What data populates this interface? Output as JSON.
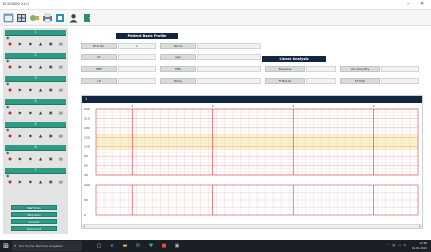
{
  "app": {
    "title": "ECG5000 v1.0"
  },
  "window_controls": {
    "minimize": "–",
    "close": "✕"
  },
  "toolbar": {
    "icons": [
      "open-file-icon",
      "grid-view-icon",
      "connect-device-icon",
      "print-icon",
      "export-icon",
      "user-icon",
      "exit-icon"
    ]
  },
  "sidebar": {
    "devices": [
      {
        "number": "1"
      },
      {
        "number": "2"
      },
      {
        "number": "3"
      },
      {
        "number": "4"
      },
      {
        "number": "5"
      },
      {
        "number": "6"
      },
      {
        "number": "7"
      }
    ],
    "buttons": [
      "Start Scan",
      "Stop Scan",
      "Connect",
      "Disconnect"
    ]
  },
  "patient_profile": {
    "title": "Patient Basic Profile",
    "fields": {
      "id_label": "ECG No.",
      "id_value": "1",
      "name_label": "Name",
      "name_value": "",
      "gender_label": "ID",
      "gender_value": "",
      "age_label": "Age",
      "age_value": "",
      "ebp_label": "EBP",
      "ebp_value": "",
      "ebs_label": "EBS",
      "ebs_value": "",
      "lh_label": "LH",
      "lh_value": "",
      "parity_label": "Parity",
      "parity_value": ""
    }
  },
  "linear_analysis": {
    "title": "Linear Analysis",
    "baseline_label": "Baseline",
    "baseline_value": "",
    "var_label": "Var.ampl/lity",
    "var_value": "",
    "fhr_label": "FHR/10p",
    "fhr_value": "",
    "acc_label": "ST/STp",
    "acc_value": "",
    "empty_value": ""
  },
  "chart_window": {
    "title": "1"
  },
  "chart_data": {
    "type": "line",
    "title": "",
    "fhr_ticks": [
      "240",
      "210",
      "180",
      "150",
      "120",
      "90",
      "60",
      "30"
    ],
    "toco_ticks": [
      "100",
      "50",
      "0"
    ],
    "minute_marks": [
      "1",
      "2",
      "3",
      "4"
    ],
    "normal_band": [
      110,
      160
    ],
    "grid": true,
    "series": []
  },
  "taskbar": {
    "search_text": "Zur Suche Text hier eingeben",
    "time": "12:00",
    "date": "01.01.2021",
    "apps": [
      "task-view-icon",
      "edge-icon",
      "explorer-icon",
      "mail-icon",
      "ecg-app-icon",
      "office-icon"
    ]
  }
}
